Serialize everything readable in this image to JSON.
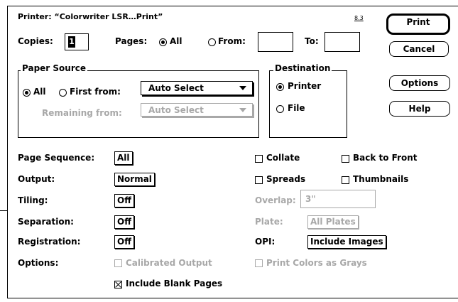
{
  "window": {
    "title": "Printer: “Colorwriter LSR…Print”",
    "version": "8.3"
  },
  "buttons": {
    "print": "Print",
    "cancel": "Cancel",
    "options": "Options",
    "help": "Help"
  },
  "copies": {
    "label": "Copies:",
    "value": "1"
  },
  "pages": {
    "label": "Pages:",
    "all": "All",
    "from": "From:",
    "to": "To:",
    "from_value": "",
    "to_value": ""
  },
  "paper_source": {
    "title": "Paper Source",
    "all": "All",
    "first_from": "First from:",
    "first_from_value": "Auto Select",
    "remaining_from": "Remaining from:",
    "remaining_from_value": "Auto Select"
  },
  "destination": {
    "title": "Destination",
    "printer": "Printer",
    "file": "File"
  },
  "settings": {
    "page_sequence": {
      "label": "Page Sequence:",
      "value": "All"
    },
    "output": {
      "label": "Output:",
      "value": "Normal"
    },
    "tiling": {
      "label": "Tiling:",
      "value": "Off"
    },
    "separation": {
      "label": "Separation:",
      "value": "Off"
    },
    "registration": {
      "label": "Registration:",
      "value": "Off"
    },
    "options": {
      "label": "Options:",
      "calibrated_output": "Calibrated Output",
      "include_blank_pages": "Include Blank Pages"
    }
  },
  "right_options": {
    "collate": "Collate",
    "back_to_front": "Back to Front",
    "spreads": "Spreads",
    "thumbnails": "Thumbnails",
    "overlap_label": "Overlap:",
    "overlap_value": "3\"",
    "plate_label": "Plate:",
    "plate_value": "All Plates",
    "opi_label": "OPI:",
    "opi_value": "Include Images",
    "print_colors_as_grays": "Print Colors as Grays"
  },
  "state": {
    "pages_all": true,
    "pages_from": false,
    "paper_all": true,
    "paper_first": false,
    "dest_printer": true,
    "dest_file": false,
    "collate": false,
    "back_to_front": false,
    "spreads": false,
    "thumbnails": false,
    "calibrated_output": false,
    "include_blank_pages": true,
    "print_colors_as_grays": false
  }
}
